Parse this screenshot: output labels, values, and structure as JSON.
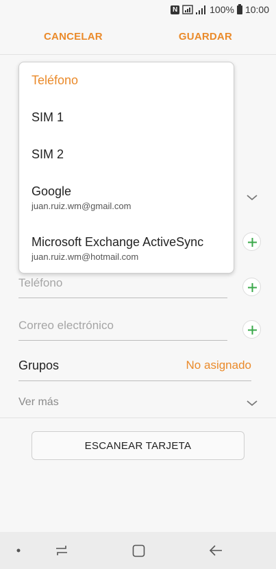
{
  "status_bar": {
    "badge": "N",
    "battery": "100%",
    "time": "10:00"
  },
  "action_bar": {
    "cancel_label": "CANCELAR",
    "save_label": "GUARDAR"
  },
  "dropdown": {
    "items": [
      {
        "title": "Teléfono",
        "subtitle": "",
        "selected": true
      },
      {
        "title": "SIM 1",
        "subtitle": ""
      },
      {
        "title": "SIM 2",
        "subtitle": ""
      },
      {
        "title": "Google",
        "subtitle": "juan.ruiz.wm@gmail.com"
      },
      {
        "title": "Microsoft Exchange ActiveSync",
        "subtitle": "juan.ruiz.wm@hotmail.com"
      }
    ]
  },
  "form": {
    "phone_placeholder": "Teléfono",
    "email_placeholder": "Correo electrónico",
    "groups_label": "Grupos",
    "groups_value": "No asignado",
    "see_more_label": "Ver más",
    "scan_button_label": "ESCANEAR TARJETA"
  },
  "colors": {
    "accent": "#ea8a2a",
    "plus_green": "#3aa84a",
    "background": "#f7f7f7"
  },
  "icons": {
    "chevron": "chevron-down-icon",
    "add": "plus-icon",
    "nav_recents": "recents-icon",
    "nav_home": "home-icon",
    "nav_back": "back-icon"
  }
}
